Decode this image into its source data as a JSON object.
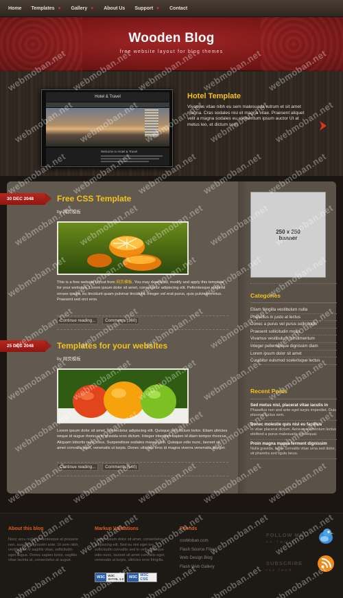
{
  "nav": {
    "items": [
      {
        "label": "Home",
        "dropdown": false
      },
      {
        "label": "Templates",
        "dropdown": true
      },
      {
        "label": "Gallery",
        "dropdown": true
      },
      {
        "label": "About Us",
        "dropdown": false
      },
      {
        "label": "Support",
        "dropdown": true
      },
      {
        "label": "Contact",
        "dropdown": false
      }
    ]
  },
  "header": {
    "title": "Wooden Blog",
    "subtitle": "free website layout for blog themes"
  },
  "featured": {
    "title": "Hotel Template",
    "text": "Vivamus vitae nibh eu sem malesuada rutrum et sit amet magna. Cras sodales nisi et magna vitae. Praesent aliquet velit a magna sodales eu elementum ipsum auctor Ut at metus leo, et dictum sem.",
    "screen_title": "Hotel & Travel",
    "screen_caption": "Welcome to Hotel & Travel"
  },
  "posts": [
    {
      "date": "30 DEC 2048",
      "title": "Free CSS Template",
      "by_prefix": "by",
      "author": "网页模板",
      "text_before": "This is a free website layout from ",
      "text_link": "网页模板",
      "text_after": ". You may download, modify and apply this template for your websites. Lorem ipsum dolor sit amet, consectetur adipiscing elit. Pellentesque eleifend ornare ipsum, eu tincidunt quam pulvinar tincidunt. Integer vel erat purus, quis pulvinar metus. Praesent sed orci eros.",
      "continue": "Continue reading...",
      "comments": "Comments (360)"
    },
    {
      "date": "25 DEC 2048",
      "title": "Templates for your websites",
      "by_prefix": "by",
      "author": "网页模板",
      "text": "Lorem ipsum dolor sit amet, consectetur adipiscing elit. Quisque non dictum tortor. Etiam ultricies neque id augue rhoncus in gravida eros dictum. Integer interdum sapien id diam tempor rhoncus. Aliquam lobortis nunc risus. Suspendisse sodales massa velit. Quisque odio nunc, laoreet sit amet convallis eget, venenatis ut turpis. Donec ultricies eros id magna viverra venenatis at eget.",
      "continue": "Continue reading...",
      "comments": "Comments (540)"
    }
  ],
  "sidebar": {
    "banner_line1": "250 x 250",
    "banner_line2": "banner",
    "categories_title": "Categories",
    "categories": [
      "Etiam fringilla vestibulum nulla",
      "Phasellus in justo at lectus",
      "Donec a purus vel purus sollicitudin",
      "Praesent sollicitudin mollis",
      "Vivamus vestibulum condimentum",
      "Integer pellentesque dignissim diam",
      "Lorem ipsum dolor sit amet",
      "Curabitur euismod scelerisque lectus"
    ],
    "recent_title": "Recent Posts",
    "recent": [
      {
        "title": "Sed metus nisl, placerat vitae iaculis in",
        "desc": "Phasellus non and ante eget turpis imperdiet. Duis placerat luctus sem."
      },
      {
        "title": "Donec molestie quis nisl eu facilisis",
        "desc": "In vitae placerat dictum. Aenean elementum lectus eleifend a purus malesuada consequat."
      },
      {
        "title": "Proin magna massa ferment dignissim",
        "desc": "Nulla gravida, lacus convallis vitae urna sed dolor, sit pharetra sed ligula lacus."
      }
    ]
  },
  "footer": {
    "about_title": "About this blog",
    "about_text": "Nunc arcu nulla, pellentesque at posuere non, suscipit dignissim ante. Ut sem nibh, vestibulum id sagittis vitae, sollicitudin eget augue. Donec sapien tortor, sagittis vitae lacinia at, consectetur at augue.",
    "markup_title": "Markup Validations",
    "markup_text": "Lorem ipsum dolor sit amet, consectetur adipiscing elit. Sed eu nisi eget leo sollicitudin convallis sed in velit. Quisque odio nunc, laoreet sit amet convallis eget, venenatis ut turpis, ultricies eros fringilla.",
    "badge_xhtml": "W3C XHTML 1.0",
    "badge_css": "W3C CSS",
    "friends_title": "Friends",
    "friends": [
      "cssMoban.com",
      "Flash Source Files",
      "Web Design Blog",
      "Flash Web Gallery"
    ],
    "follow_title": "FOLLOW ME",
    "follow_sub": "on Twitter",
    "subscribe_title": "SUBSCRIBE",
    "subscribe_sub": "rss feed"
  },
  "watermark": "webmoban.net",
  "colors": {
    "accent": "#f2c21e",
    "header_red": "#8f1c1c",
    "badge_red": "#a41d15",
    "footer_orange": "#e25b1e"
  }
}
